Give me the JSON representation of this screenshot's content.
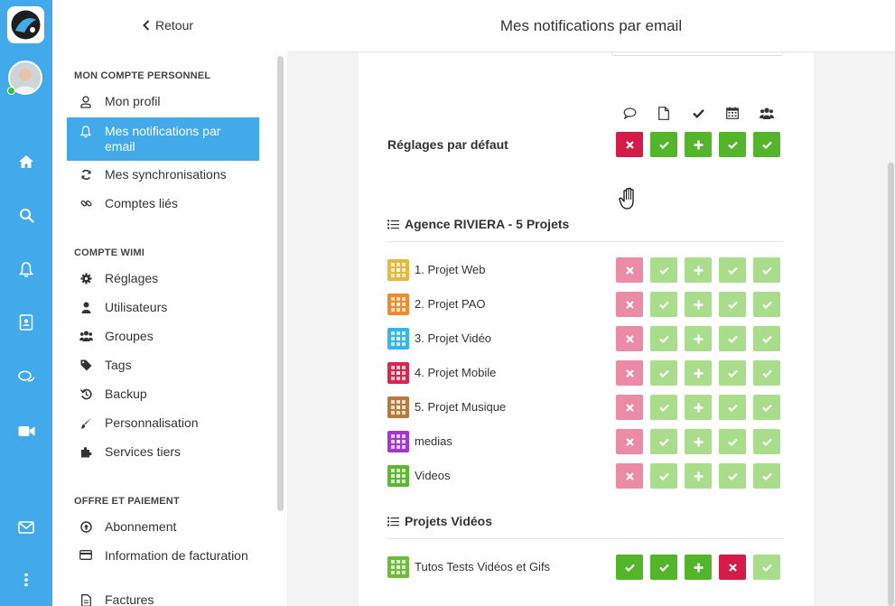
{
  "header": {
    "title": "Mes notifications par email",
    "back_label": "Retour"
  },
  "sidebar": {
    "sections": [
      {
        "title": "MON COMPTE PERSONNEL",
        "items": [
          {
            "label": "Mon profil",
            "icon": "user-icon"
          },
          {
            "label": "Mes notifications par email",
            "icon": "bell-icon",
            "active": true
          },
          {
            "label": "Mes synchronisations",
            "icon": "sync-icon"
          },
          {
            "label": "Comptes liés",
            "icon": "link-icon"
          }
        ]
      },
      {
        "title": "COMPTE WIMI",
        "items": [
          {
            "label": "Réglages",
            "icon": "gear-icon"
          },
          {
            "label": "Utilisateurs",
            "icon": "user-solid-icon"
          },
          {
            "label": "Groupes",
            "icon": "users-icon"
          },
          {
            "label": "Tags",
            "icon": "tag-icon"
          },
          {
            "label": "Backup",
            "icon": "history-icon"
          },
          {
            "label": "Personnalisation",
            "icon": "brush-icon"
          },
          {
            "label": "Services tiers",
            "icon": "puzzle-icon"
          }
        ]
      },
      {
        "title": "OFFRE ET PAIEMENT",
        "items": [
          {
            "label": "Abonnement",
            "icon": "arrow-up-circle-icon"
          },
          {
            "label": "Information de facturation",
            "icon": "credit-card-icon"
          },
          {
            "label": "Factures",
            "icon": "document-icon"
          }
        ]
      }
    ]
  },
  "columns": [
    "comment-icon",
    "file-icon",
    "check-icon",
    "calendar-icon",
    "users-icon"
  ],
  "default_settings": {
    "label": "Réglages par défaut",
    "states": [
      "off",
      "on",
      "on",
      "on",
      "on"
    ]
  },
  "groups": [
    {
      "title": "Agence RIVIERA - 5 Projets",
      "projects": [
        {
          "name": "1. Projet Web",
          "color": "#e7b93a",
          "states": [
            "off",
            "on",
            "on",
            "on",
            "on"
          ],
          "dim": true
        },
        {
          "name": "2. Projet PAO",
          "color": "#f08b2b",
          "states": [
            "off",
            "on",
            "on",
            "on",
            "on"
          ],
          "dim": true
        },
        {
          "name": "3. Projet Vidéo",
          "color": "#34b6ea",
          "states": [
            "off",
            "on",
            "on",
            "on",
            "on"
          ],
          "dim": true
        },
        {
          "name": "4. Projet Mobile",
          "color": "#d8264e",
          "states": [
            "off",
            "on",
            "on",
            "on",
            "on"
          ],
          "dim": true
        },
        {
          "name": "5. Projet Musique",
          "color": "#b77a3a",
          "states": [
            "off",
            "on",
            "on",
            "on",
            "on"
          ],
          "dim": true
        },
        {
          "name": "medias",
          "color": "#a236d4",
          "states": [
            "off",
            "on",
            "on",
            "on",
            "on"
          ],
          "dim": true
        },
        {
          "name": "Videos",
          "color": "#5cb82e",
          "states": [
            "off",
            "on",
            "on",
            "on",
            "on"
          ],
          "dim": true
        }
      ]
    },
    {
      "title": "Projets Vidéos",
      "projects": [
        {
          "name": "Tutos Tests Vidéos et Gifs",
          "color": "#6bbd3a",
          "states": [
            "on",
            "on",
            "on",
            "off",
            "on"
          ],
          "dim": false,
          "dim_cols": [
            4
          ]
        }
      ]
    }
  ],
  "colors": {
    "accent": "#42aaeb",
    "on": "#52b52a",
    "off": "#d41c4a",
    "on_dim": "#a9dd8b",
    "off_dim": "#ec8ba5"
  }
}
